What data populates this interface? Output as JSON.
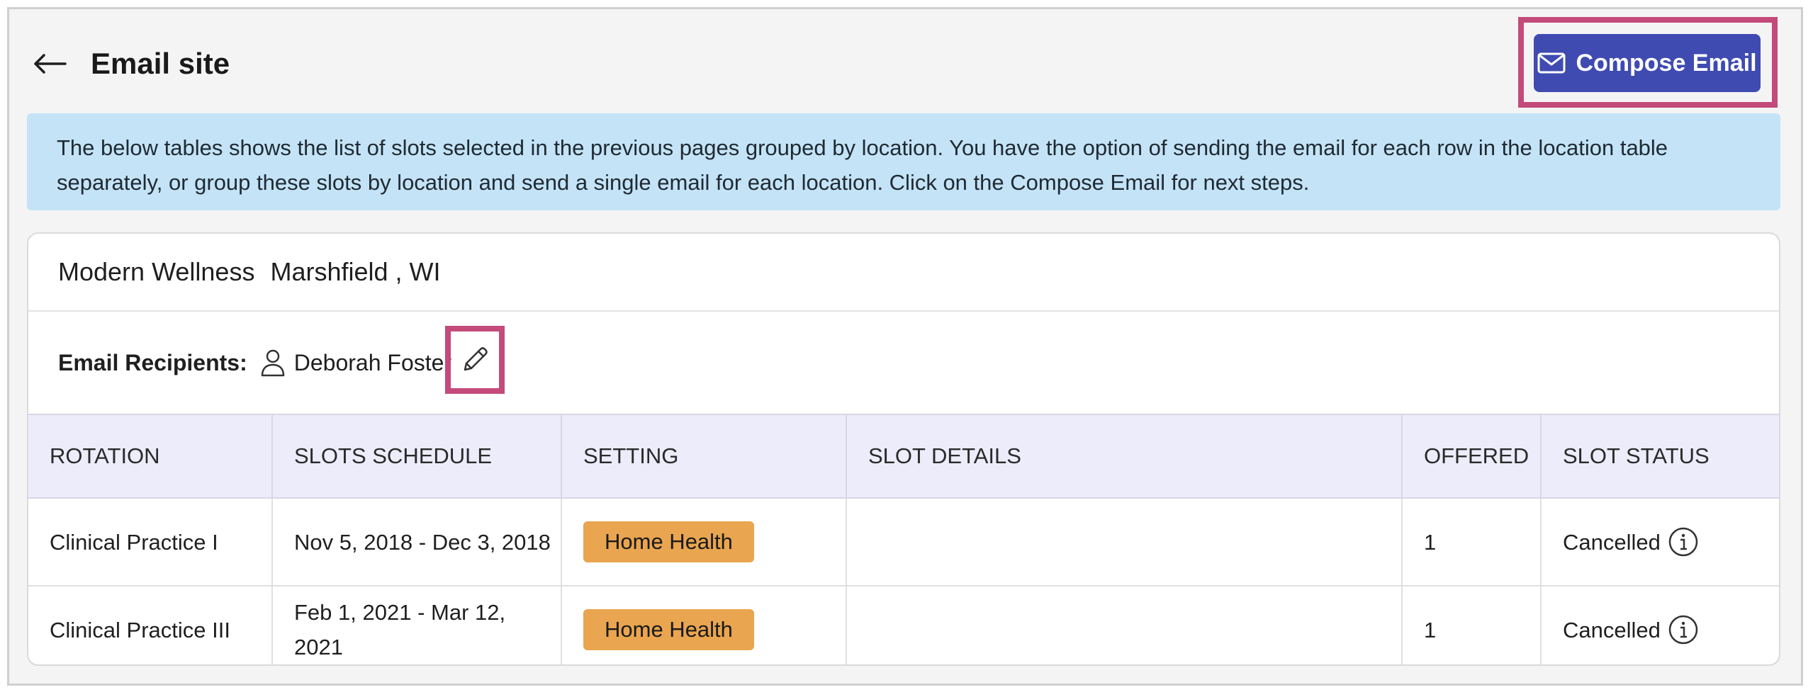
{
  "header": {
    "back_icon": "arrow-left-icon",
    "title": "Email site",
    "compose_button_label": "Compose Email",
    "compose_icon": "mail-icon"
  },
  "banner": {
    "text": "The below tables shows the list of slots selected in the previous pages grouped by location. You have the option of sending the email for each row in the location table separately, or group these slots by location and send a single email for each location. Click on the Compose Email for next steps."
  },
  "location": {
    "name": "Modern Wellness",
    "city": "Marshfield , WI"
  },
  "recipients": {
    "label": "Email Recipients:",
    "person_icon": "person-icon",
    "name": "Deborah Foster",
    "edit_icon": "pencil-icon"
  },
  "table": {
    "columns": [
      "ROTATION",
      "SLOTS SCHEDULE",
      "SETTING",
      "SLOT DETAILS",
      "OFFERED",
      "SLOT STATUS"
    ],
    "rows": [
      {
        "rotation": "Clinical Practice I",
        "schedule": "Nov 5, 2018 - Dec 3, 2018",
        "setting": "Home Health",
        "details": "",
        "offered": "1",
        "status": "Cancelled"
      },
      {
        "rotation": "Clinical Practice III",
        "schedule": "Feb 1, 2021 - Mar 12, 2021",
        "setting": "Home Health",
        "details": "",
        "offered": "1",
        "status": "Cancelled"
      }
    ]
  },
  "colors": {
    "primary": "#3f4bb1",
    "highlight": "#c34a7a",
    "banner": "#c4e3f6",
    "badge": "#e9a54f",
    "table_header": "#ececfb"
  }
}
